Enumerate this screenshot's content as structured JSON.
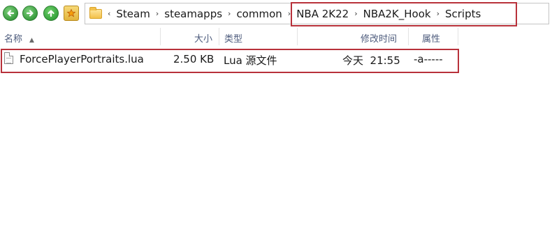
{
  "toolbar": {
    "back_icon": "back-arrow-icon",
    "forward_icon": "forward-arrow-icon",
    "up_icon": "up-arrow-icon",
    "favorites_icon": "star-folder-icon"
  },
  "breadcrumb": {
    "separator": "›",
    "items": [
      "Steam",
      "steamapps",
      "common",
      "NBA 2K22",
      "NBA2K_Hook",
      "Scripts"
    ]
  },
  "columns": {
    "name": "名称",
    "size": "大小",
    "type": "类型",
    "modified": "修改时间",
    "attributes": "属性"
  },
  "files": [
    {
      "name": "ForcePlayerPortraits.lua",
      "size": "2.50 KB",
      "type": "Lua 源文件",
      "modified": "今天  21:55",
      "attributes": "-a-----"
    }
  ],
  "colors": {
    "highlight": "#b8313a",
    "header_text": "#4d5b7c",
    "nav_green": "#3a9d3f"
  }
}
